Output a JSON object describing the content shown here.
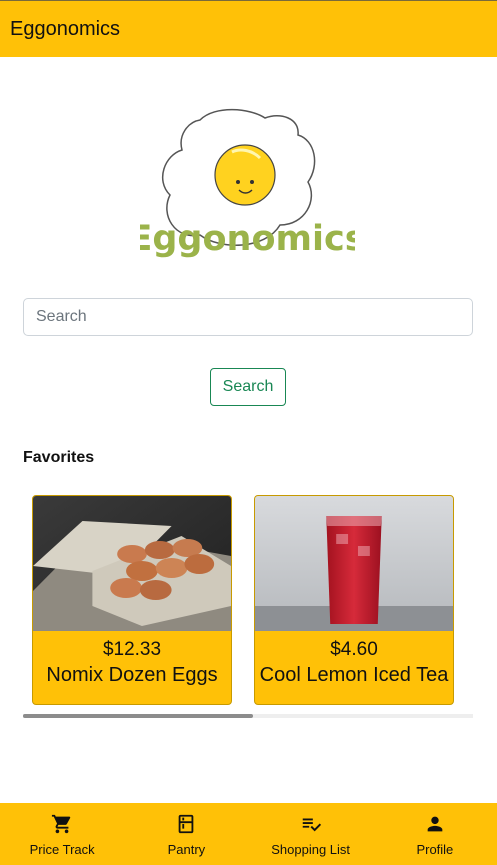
{
  "header": {
    "title": "Eggonomics"
  },
  "logo": {
    "text": "Eggonomics",
    "text_color": "#9bb34a",
    "yolk_color": "#ffd21f"
  },
  "search": {
    "placeholder": "Search",
    "button_label": "Search"
  },
  "favorites": {
    "title": "Favorites",
    "items": [
      {
        "price": "$12.33",
        "name": "Nomix Dozen Eggs"
      },
      {
        "price": "$4.60",
        "name": "Cool Lemon Iced Tea"
      }
    ],
    "scroll_fraction_visible": 0.51
  },
  "bottom_nav": {
    "items": [
      {
        "label": "Price Track",
        "icon": "cart-icon"
      },
      {
        "label": "Pantry",
        "icon": "fridge-icon"
      },
      {
        "label": "Shopping List",
        "icon": "playlist-check-icon"
      },
      {
        "label": "Profile",
        "icon": "person-icon"
      }
    ]
  },
  "colors": {
    "accent": "#ffc107",
    "search_button": "#198754"
  }
}
